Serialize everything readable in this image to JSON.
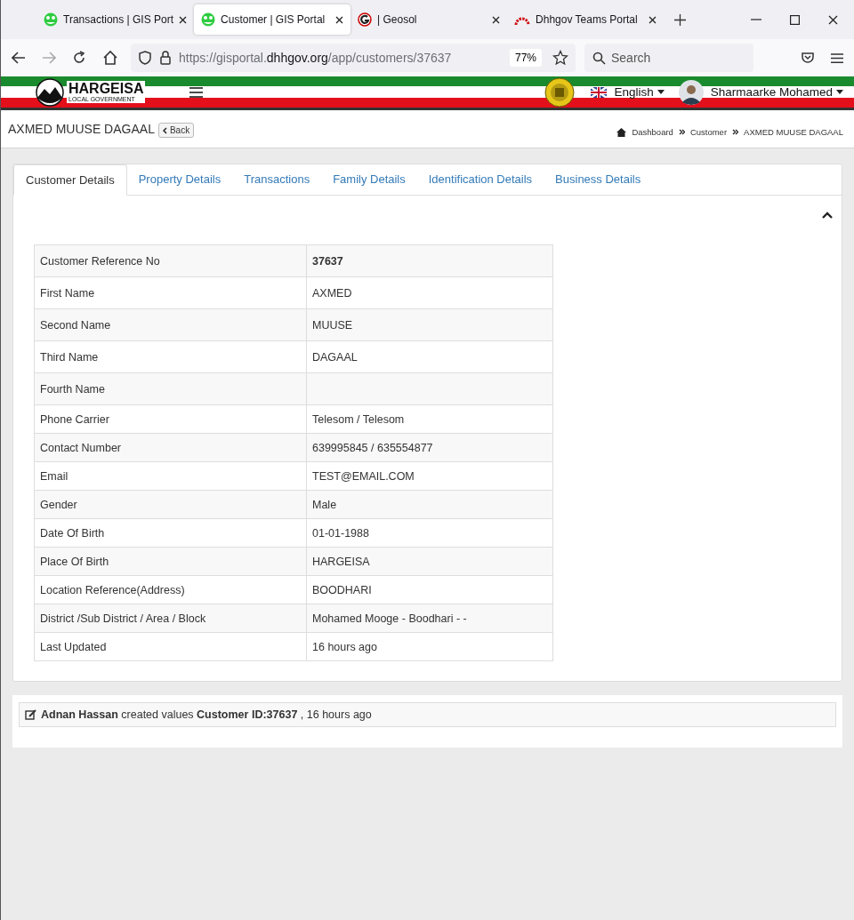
{
  "browser": {
    "tabs": [
      {
        "title": "Transactions | GIS Port",
        "selected": false
      },
      {
        "title": "Customer | GIS Portal",
        "selected": true
      },
      {
        "title": "| Geosol",
        "selected": false
      },
      {
        "title": "Dhhgov Teams Portal",
        "selected": false
      }
    ],
    "url": {
      "prefix": "https://gisportal.",
      "domain": "dhhgov.org",
      "path": "/app/customers/37637"
    },
    "zoom": "77%",
    "search": {
      "placeholder": "Search"
    }
  },
  "header": {
    "brand": "HARGEISA",
    "brand_sub": "LOCAL GOVERNMENT",
    "language": "English",
    "user": "Sharmaarke Mohamed"
  },
  "page": {
    "title": "AXMED MUUSE DAGAAL",
    "back": "Back",
    "breadcrumb": [
      "Dashboard",
      "Customer",
      "AXMED MUUSE DAGAAL"
    ]
  },
  "tabs": [
    {
      "label": "Customer Details",
      "selected": true
    },
    {
      "label": "Property Details",
      "selected": false
    },
    {
      "label": "Transactions",
      "selected": false
    },
    {
      "label": "Family Details",
      "selected": false
    },
    {
      "label": "Identification Details",
      "selected": false
    },
    {
      "label": "Business Details",
      "selected": false
    }
  ],
  "details": [
    {
      "label": "Customer Reference No",
      "value": "37637",
      "emphasis": true
    },
    {
      "label": "First Name",
      "value": "AXMED",
      "emphasis": false
    },
    {
      "label": "Second Name",
      "value": "MUUSE",
      "emphasis": false
    },
    {
      "label": "Third Name",
      "value": "DAGAAL",
      "emphasis": false
    },
    {
      "label": "Fourth Name"
    },
    {
      "label": "Phone Carrier",
      "value": "Telesom / Telesom",
      "emphasis": false
    },
    {
      "label": "Contact Number",
      "value": "639995845 / 635554877",
      "emphasis": false
    },
    {
      "label": "Email",
      "value": "TEST@EMAIL.COM",
      "emphasis": false
    },
    {
      "label": "Gender",
      "value": "Male",
      "emphasis": false
    },
    {
      "label": "Date Of Birth",
      "value": "01-01-1988",
      "emphasis": false
    },
    {
      "label": "Place Of Birth",
      "value": "HARGEISA",
      "emphasis": false
    },
    {
      "label": "Location Reference(Address)",
      "value": "BOODHARI",
      "emphasis": false
    },
    {
      "label": "District /Sub District / Area / Block",
      "value": "Mohamed Mooge - Boodhari - -",
      "emphasis": false
    },
    {
      "label": "Last Updated",
      "value": "16 hours ago",
      "emphasis": false
    }
  ],
  "activity": [
    "**Adnan Hassan** created values **Customer ID:37637** , 16 hours ago"
  ]
}
